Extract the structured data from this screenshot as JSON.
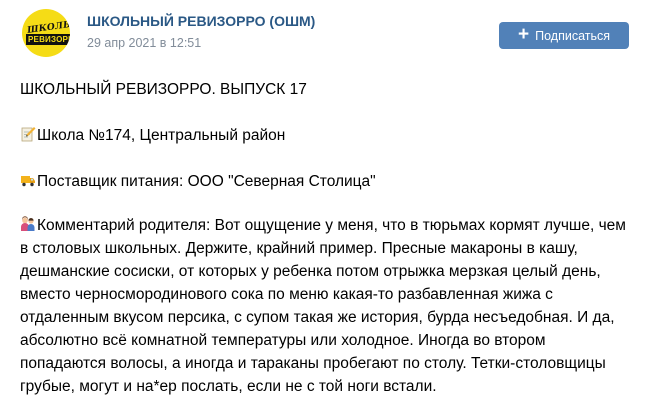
{
  "header": {
    "avatar_logo_line1": "ШКОЛЬНЫЙ",
    "avatar_logo_line2": "РЕВИЗОРРО",
    "group_name": "ШКОЛЬНЫЙ РЕВИЗОРРО (ОШМ)",
    "post_date": "29 апр 2021 в 12:51",
    "subscribe_label": "Подписаться",
    "subscribe_icon": "plus-icon"
  },
  "post": {
    "title": "ШКОЛЬНЫЙ РЕВИЗОРРО. ВЫПУСК 17",
    "school_icon": "memo-icon",
    "school": "Школа №174, Центральный район",
    "supplier_icon": "truck-icon",
    "supplier": "Поставщик питания: ООО \"Северная Столица\"",
    "comment_icon": "family-icon",
    "comment": "Комментарий родителя: Вот ощущение у меня, что в тюрьмах кормят лучше, чем в столовых школьных. Держите, крайний пример. Пресные макароны в кашу, дешманские сосиски, от которых у ребенка потом отрыжка мерзкая целый день, вместо черносмородинового сока по меню какая-то разбавленная жижа с отдаленным вкусом персика, с супом такая же история, бурда несъедобная. И да, абсолютно всё комнатной температуры или холодное. Иногда во втором попадаются волосы, а иногда и тараканы пробегают по столу. Тетки-столовщицы грубые, могут и на*ер послать, если не с той ноги встали."
  },
  "colors": {
    "link": "#2a5885",
    "muted": "#818c99",
    "button": "#5181b8",
    "avatar_bg": "#f5dc16"
  }
}
